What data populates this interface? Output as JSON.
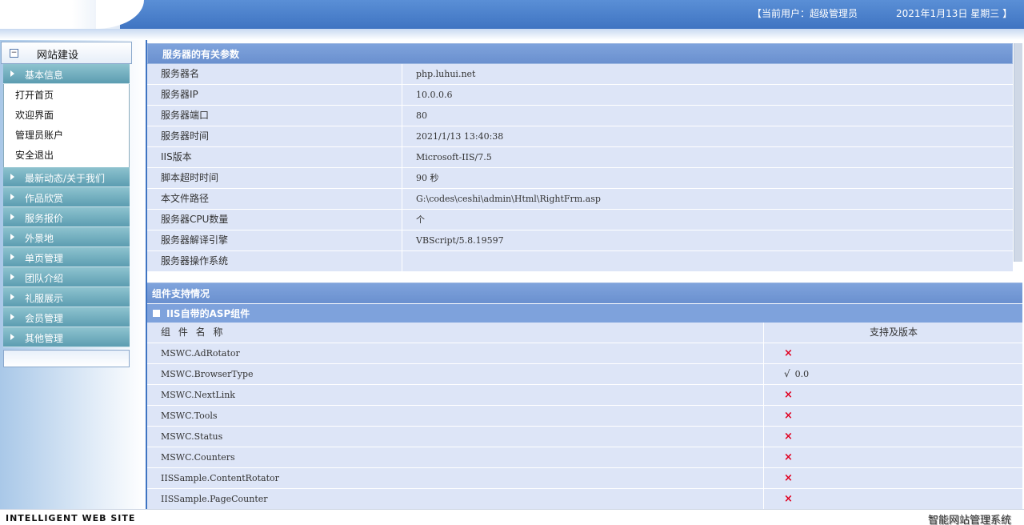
{
  "header": {
    "current_user": "【当前用户：超级管理员",
    "date": "2021年1月13日 星期三 】"
  },
  "sidebar": {
    "title": "网站建设",
    "collapse_symbol": "−",
    "groups": [
      {
        "label": "基本信息",
        "expanded": true,
        "items": [
          "打开首页",
          "欢迎界面",
          "管理员账户",
          "安全退出"
        ]
      },
      {
        "label": "最新动态/关于我们"
      },
      {
        "label": "作品欣赏"
      },
      {
        "label": "服务报价"
      },
      {
        "label": "外景地"
      },
      {
        "label": "单页管理"
      },
      {
        "label": "团队介绍"
      },
      {
        "label": "礼服展示"
      },
      {
        "label": "会员管理"
      },
      {
        "label": "其他管理"
      }
    ]
  },
  "server_panel": {
    "title": "服务器的有关参数",
    "rows": [
      {
        "key": "服务器名",
        "value": "php.luhui.net"
      },
      {
        "key": "服务器IP",
        "value": "10.0.0.6"
      },
      {
        "key": "服务器端口",
        "value": "80"
      },
      {
        "key": "服务器时间",
        "value": "2021/1/13 13:40:38"
      },
      {
        "key": "IIS版本",
        "value": "Microsoft-IIS/7.5"
      },
      {
        "key": "脚本超时时间",
        "value": "90 秒"
      },
      {
        "key": "本文件路径",
        "value": "G:\\codes\\ceshi\\admin\\Html\\RightFrm.asp"
      },
      {
        "key": "服务器CPU数量",
        "value": " 个"
      },
      {
        "key": "服务器解译引擎",
        "value": "VBScript/5.8.19597"
      },
      {
        "key": "服务器操作系统",
        "value": ""
      }
    ]
  },
  "component_panel": {
    "title": "组件支持情况",
    "subtitle": "IIS自带的ASP组件",
    "col_name": "组 件 名 称",
    "col_support": "支持及版本",
    "unsupported_symbol": "×",
    "supported_symbol": "√",
    "rows": [
      {
        "name": "MSWC.AdRotator",
        "supported": false,
        "version": ""
      },
      {
        "name": "MSWC.BrowserType",
        "supported": true,
        "version": "0.0"
      },
      {
        "name": "MSWC.NextLink",
        "supported": false,
        "version": ""
      },
      {
        "name": "MSWC.Tools",
        "supported": false,
        "version": ""
      },
      {
        "name": "MSWC.Status",
        "supported": false,
        "version": ""
      },
      {
        "name": "MSWC.Counters",
        "supported": false,
        "version": ""
      },
      {
        "name": "IISSample.ContentRotator",
        "supported": false,
        "version": ""
      },
      {
        "name": "IISSample.PageCounter",
        "supported": false,
        "version": ""
      }
    ]
  },
  "footer": {
    "left": "INTELLIGENT WEB  SITE",
    "right": "智能网站管理系统"
  },
  "colors": {
    "header_blue": "#3f74c2",
    "panel_title": "#7ea2dc",
    "row_bg": "#dde5f7",
    "menu_teal": "#5c9db1",
    "cross_red": "#e00020"
  }
}
